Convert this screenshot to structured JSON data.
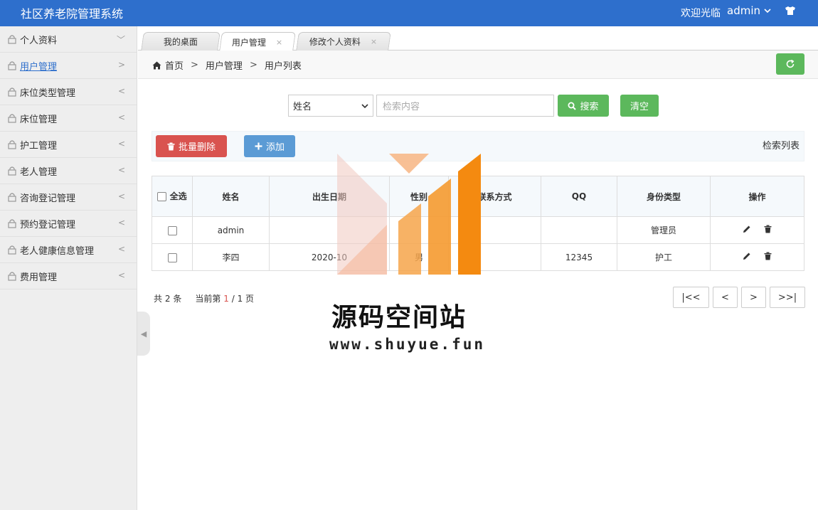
{
  "header": {
    "title": "社区养老院管理系统",
    "welcome": "欢迎光临",
    "username": "admin"
  },
  "sidebar": {
    "items": [
      {
        "label": "个人资料",
        "chev": "﹀"
      },
      {
        "label": "用户管理",
        "chev": ">"
      },
      {
        "label": "床位类型管理",
        "chev": "<"
      },
      {
        "label": "床位管理",
        "chev": "<"
      },
      {
        "label": "护工管理",
        "chev": "<"
      },
      {
        "label": "老人管理",
        "chev": "<"
      },
      {
        "label": "咨询登记管理",
        "chev": "<"
      },
      {
        "label": "预约登记管理",
        "chev": "<"
      },
      {
        "label": "老人健康信息管理",
        "chev": "<"
      },
      {
        "label": "费用管理",
        "chev": "<"
      }
    ],
    "active_index": 1
  },
  "tabs": [
    {
      "label": "我的桌面"
    },
    {
      "label": "用户管理",
      "close": "×"
    },
    {
      "label": "修改个人资料",
      "close": "×"
    }
  ],
  "breadcrumb": [
    "首页",
    "用户管理",
    "用户列表"
  ],
  "breadcrumb_sep": ">",
  "search": {
    "field_selected": "姓名",
    "placeholder": "检索内容",
    "search_label": "搜索",
    "clear_label": "清空"
  },
  "toolbar": {
    "batch_delete_label": "批量删除",
    "add_label": "添加",
    "list_title": "检索列表"
  },
  "table": {
    "select_all": "全选",
    "columns": [
      "姓名",
      "出生日期",
      "性别",
      "联系方式",
      "QQ",
      "身份类型",
      "操作"
    ],
    "rows": [
      {
        "name": "admin",
        "birth": "",
        "gender": "",
        "contact": "",
        "qq": "",
        "role": "管理员"
      },
      {
        "name": "李四",
        "birth": "2020-10",
        "gender": "男",
        "contact": "",
        "qq": "12345",
        "role": "护工"
      }
    ]
  },
  "pager": {
    "total_prefix": "共",
    "total": "2",
    "total_suffix": "条",
    "current_prefix": "当前第",
    "current": "1",
    "pages": "/ 1 页",
    "first": "|<<",
    "prev": "<",
    "next": ">",
    "last": ">>|"
  },
  "watermark": {
    "title": "源码空间站",
    "url": "www.shuyue.fun"
  },
  "colors": {
    "header_bg": "#2e6fcc",
    "green": "#5cb85c",
    "red": "#d9534f",
    "blue": "#5b9bd5"
  }
}
